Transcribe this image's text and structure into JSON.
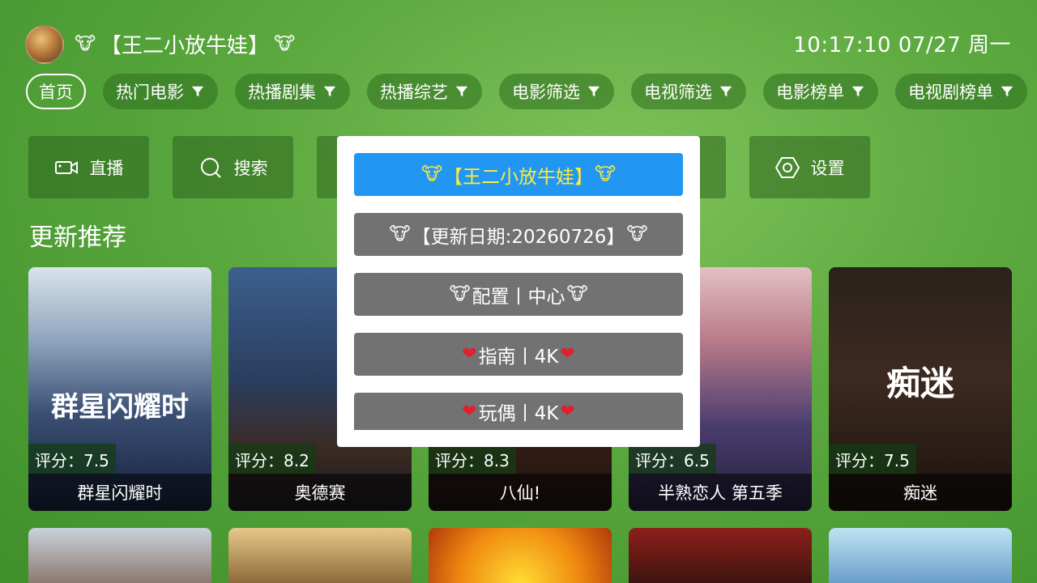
{
  "header": {
    "title": "【王二小放牛娃】",
    "cow_icon": "🐮",
    "clock": "10:17:10 07/27 周一"
  },
  "nav": [
    "首页",
    "热门电影",
    "热播剧集",
    "热播综艺",
    "电影筛选",
    "电视筛选",
    "电影榜单",
    "电视剧榜单"
  ],
  "tiles": {
    "live": "直播",
    "search": "搜索",
    "settings": "设置"
  },
  "section_title": "更新推荐",
  "posters": [
    {
      "rating": "评分：7.5",
      "title": "群星闪耀时",
      "poster_text": "群星闪耀时",
      "color1": "#c8d8e6",
      "color2": "#1a2a45"
    },
    {
      "rating": "评分：8.2",
      "title": "奥德赛",
      "poster_text": "",
      "color1": "#4a6c9a",
      "color2": "#1b2233"
    },
    {
      "rating": "评分：8.3",
      "title": "八仙!",
      "poster_text": "",
      "color1": "#6a3a2a",
      "color2": "#2a1a14"
    },
    {
      "rating": "评分：6.5",
      "title": "半熟恋人 第五季",
      "poster_text": "",
      "color1": "#c9a0a8",
      "color2": "#3a2e58"
    },
    {
      "rating": "评分：7.5",
      "title": "痴迷",
      "poster_text": "痴迷",
      "color1": "#3a2a22",
      "color2": "#0e0a08"
    }
  ],
  "modal": {
    "items": [
      {
        "prefix": "🐮",
        "text": "【王二小放牛娃】",
        "suffix": "🐮"
      },
      {
        "prefix": "🐮",
        "text": "【更新日期:20260726】",
        "suffix": "🐮"
      },
      {
        "prefix": "🐮",
        "text": "配置丨中心",
        "suffix": "🐮"
      },
      {
        "prefix": "❤",
        "text": "指南丨4K",
        "suffix": "❤"
      },
      {
        "prefix": "❤",
        "text": "玩偶丨4K",
        "suffix": "❤"
      }
    ]
  }
}
